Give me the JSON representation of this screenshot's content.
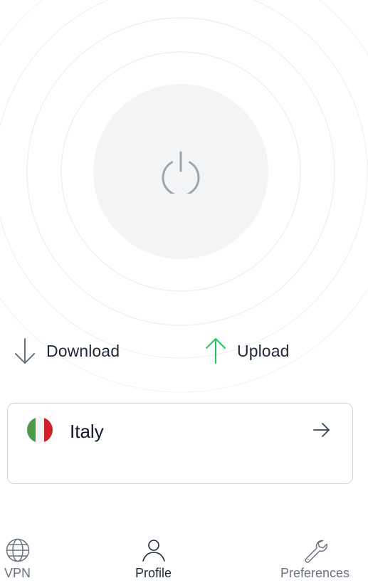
{
  "speeds": {
    "download_label": "Download",
    "upload_label": "Upload"
  },
  "location": {
    "country": "Italy",
    "flag_colors": [
      "#4c9a45",
      "#f4f4f4",
      "#d0202a"
    ]
  },
  "nav": {
    "items": [
      {
        "label": "VPN",
        "icon": "globe-icon"
      },
      {
        "label": "Profile",
        "icon": "user-icon",
        "active": true
      },
      {
        "label": "Preferences",
        "icon": "wrench-icon"
      }
    ]
  },
  "colors": {
    "download_arrow": "#6b7280",
    "upload_arrow": "#22c55e",
    "power_icon": "#9ca3af",
    "power_bg": "#f3f4f6"
  }
}
